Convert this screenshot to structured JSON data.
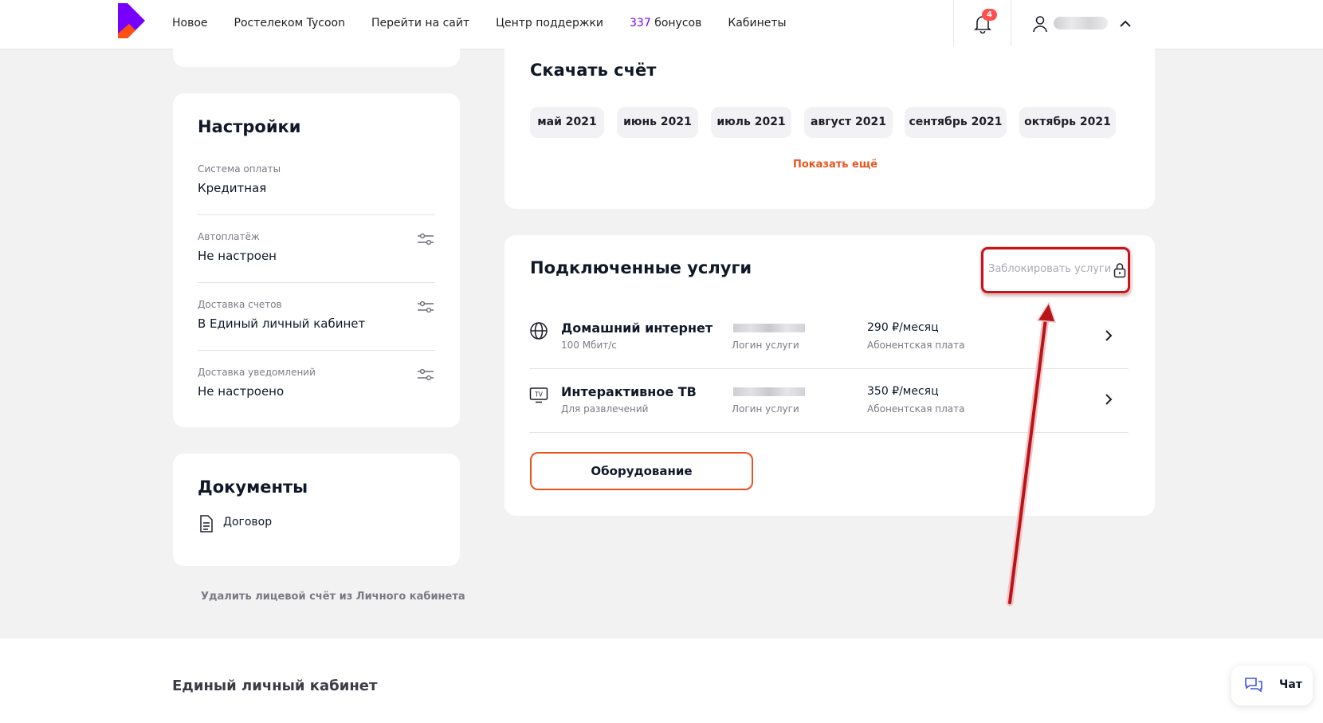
{
  "header": {
    "nav": [
      "Новое",
      "Ростелеком Tycoon",
      "Перейти на сайт",
      "Центр поддержки"
    ],
    "bonus_count": "337",
    "bonus_label": "бонусов",
    "cabinets": "Кабинеты",
    "notifications_count": "4"
  },
  "settings": {
    "title": "Настройки",
    "rows": [
      {
        "label": "Система оплаты",
        "value": "Кредитная"
      },
      {
        "label": "Автоплатёж",
        "value": "Не настроен"
      },
      {
        "label": "Доставка счетов",
        "value": "В Единый личный кабинет"
      },
      {
        "label": "Доставка уведомлений",
        "value": "Не настроено"
      }
    ]
  },
  "documents": {
    "title": "Документы",
    "items": [
      "Договор"
    ]
  },
  "delete_account": "Удалить лицевой счёт из Личного кабинета",
  "invoices": {
    "title": "Скачать счёт",
    "months": [
      "май 2021",
      "июнь 2021",
      "июль 2021",
      "август 2021",
      "сентябрь 2021",
      "октябрь 2021"
    ],
    "show_more": "Показать ещё"
  },
  "services": {
    "title": "Подключенные услуги",
    "block_label": "Заблокировать услуги",
    "items": [
      {
        "name": "Домашний интернет",
        "sub": "100 Мбит/с",
        "login_label": "Логин услуги",
        "price": "290 ₽/месяц",
        "price_label": "Абонентская плата",
        "icon": "globe-icon"
      },
      {
        "name": "Интерактивное ТВ",
        "sub": "Для развлечений",
        "login_label": "Логин услуги",
        "price": "350 ₽/месяц",
        "price_label": "Абонентская плата",
        "icon": "tv-icon"
      }
    ],
    "equipment_label": "Оборудование"
  },
  "footer": {
    "title": "Единый личный кабинет"
  },
  "chat": {
    "label": "Чат"
  },
  "colors": {
    "accent": "#e9531d",
    "brand": "#7700ff",
    "annotation": "#c3151b"
  }
}
